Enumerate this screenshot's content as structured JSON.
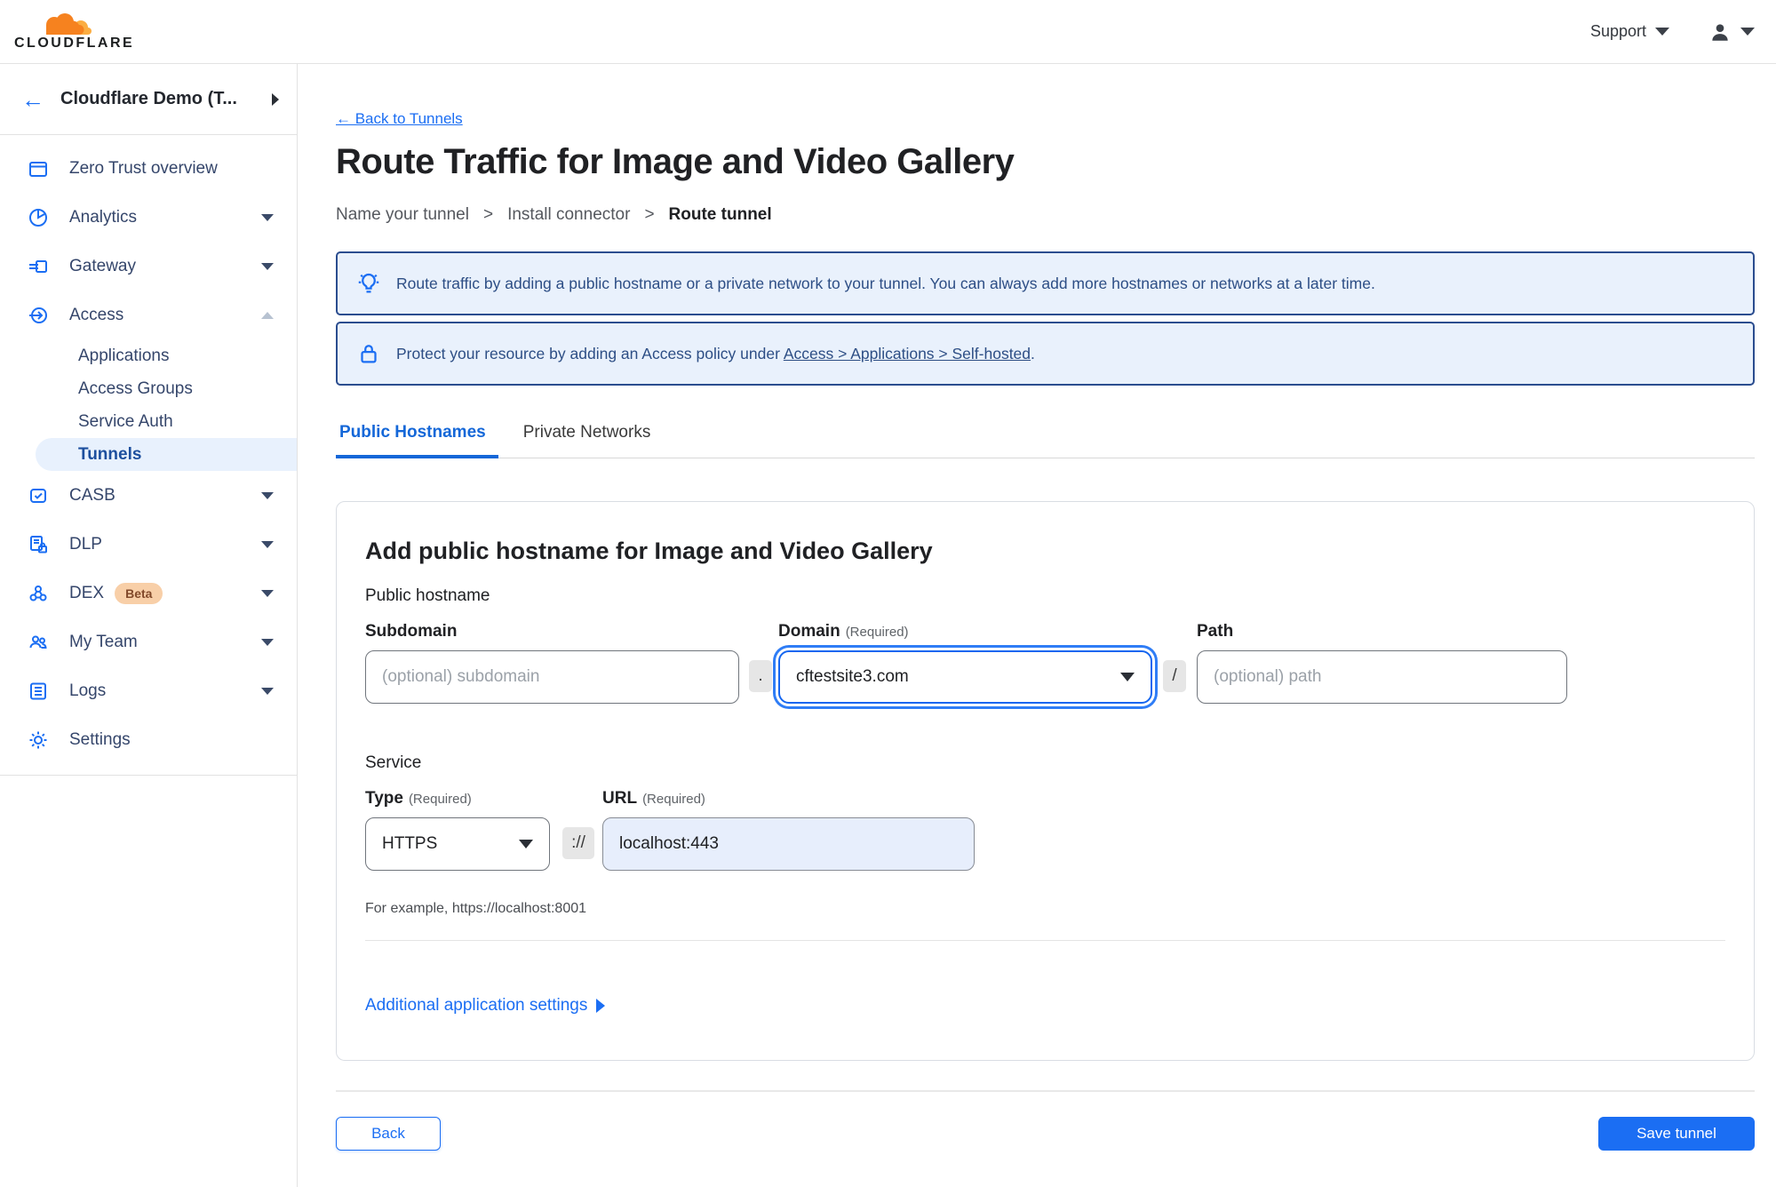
{
  "topbar": {
    "brand": "CLOUDFLARE",
    "support_label": "Support"
  },
  "sidebar": {
    "account_label": "Cloudflare Demo (T...",
    "items": [
      {
        "label": "Zero Trust overview",
        "icon": "overview-icon"
      },
      {
        "label": "Analytics",
        "icon": "analytics-icon"
      },
      {
        "label": "Gateway",
        "icon": "gateway-icon"
      },
      {
        "label": "Access",
        "icon": "access-icon"
      },
      {
        "label": "CASB",
        "icon": "casb-icon"
      },
      {
        "label": "DLP",
        "icon": "dlp-icon"
      },
      {
        "label": "DEX",
        "icon": "dex-icon",
        "badge": "Beta"
      },
      {
        "label": "My Team",
        "icon": "my-team-icon"
      },
      {
        "label": "Logs",
        "icon": "logs-icon"
      },
      {
        "label": "Settings",
        "icon": "settings-icon"
      }
    ],
    "access_subitems": [
      {
        "label": "Applications"
      },
      {
        "label": "Access Groups"
      },
      {
        "label": "Service Auth"
      },
      {
        "label": "Tunnels",
        "active": true
      }
    ]
  },
  "main": {
    "back_link": "← Back to Tunnels",
    "title": "Route Traffic for Image and Video Gallery",
    "steps": [
      {
        "label": "Name your tunnel"
      },
      {
        "label": "Install connector"
      },
      {
        "label": "Route tunnel",
        "current": true
      }
    ],
    "step_separator": ">",
    "banners": [
      {
        "icon": "lightbulb-icon",
        "text": "Route traffic by adding a public hostname or a private network to your tunnel. You can always add more hostnames or networks at a later time."
      },
      {
        "icon": "lock-icon",
        "text_prefix": "Protect your resource by adding an Access policy under ",
        "link_text": "Access > Applications > Self-hosted",
        "text_suffix": "."
      }
    ],
    "tabs": [
      {
        "label": "Public Hostnames",
        "active": true
      },
      {
        "label": "Private Networks"
      }
    ],
    "form": {
      "heading": "Add public hostname for Image and Video Gallery",
      "public_hostname_label": "Public hostname",
      "subdomain_label": "Subdomain",
      "subdomain_placeholder": "(optional) subdomain",
      "dot_separator": ".",
      "domain_label": "Domain",
      "required_label": "(Required)",
      "domain_value": "cftestsite3.com",
      "slash_separator": "/",
      "path_label": "Path",
      "path_placeholder": "(optional) path",
      "service_label": "Service",
      "type_label": "Type",
      "type_value": "HTTPS",
      "scheme_separator": "://",
      "url_label": "URL",
      "url_value": "localhost:443",
      "example_text": "For example, https://localhost:8001",
      "additional_settings_label": "Additional application settings"
    },
    "footer": {
      "back_label": "Back",
      "save_label": "Save tunnel"
    }
  },
  "colors": {
    "accent": "#1b6ef3",
    "active_nav_bg": "#e8f1fd",
    "active_nav_text": "#1d4f9e",
    "banner_bg": "#e9f1fc",
    "banner_border": "#2b4d8f",
    "banner_text": "#2d4e85",
    "badge_bg": "#f8cfa8",
    "badge_text": "#82492a",
    "url_filled_bg": "#e7eefc",
    "brand_orange": "#f6821f"
  }
}
